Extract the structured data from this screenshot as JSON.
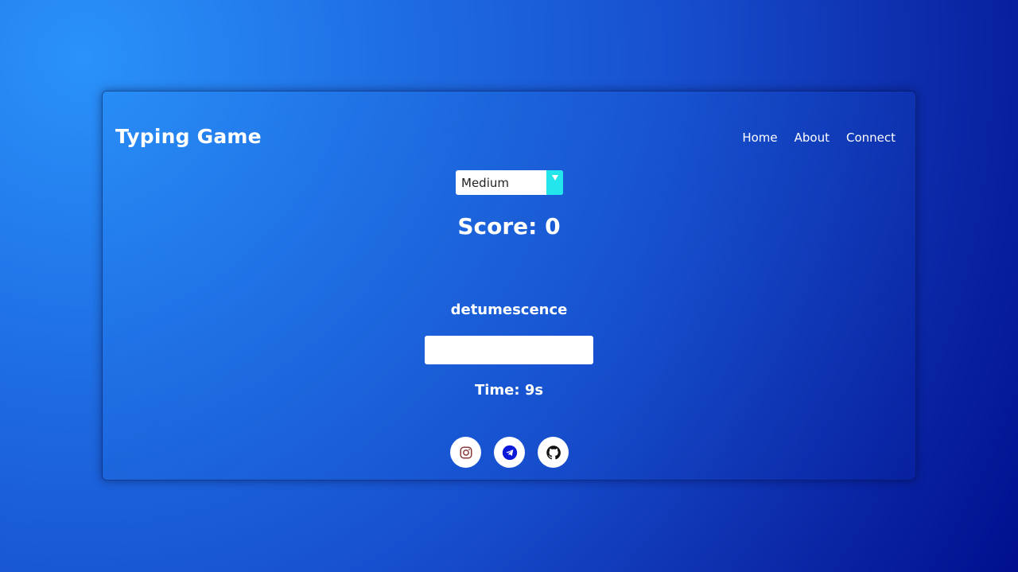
{
  "header": {
    "title": "Typing Game",
    "nav": [
      {
        "label": "Home"
      },
      {
        "label": "About"
      },
      {
        "label": "Connect"
      }
    ]
  },
  "game": {
    "difficulty": {
      "selected": "Medium"
    },
    "score_text": "Score: 0",
    "current_word": "detumescence",
    "input_value": "",
    "time_text": "Time: 9s"
  },
  "socials": [
    {
      "icon": "instagram-icon",
      "color": "#8a3a3a"
    },
    {
      "icon": "telegram-icon",
      "color": "#0a18d8"
    },
    {
      "icon": "github-icon",
      "color": "#111111"
    }
  ],
  "colors": {
    "background_light": "#2a92fa",
    "background_dark": "#000f8e",
    "select_arrow_bg": "#22e6ec"
  }
}
